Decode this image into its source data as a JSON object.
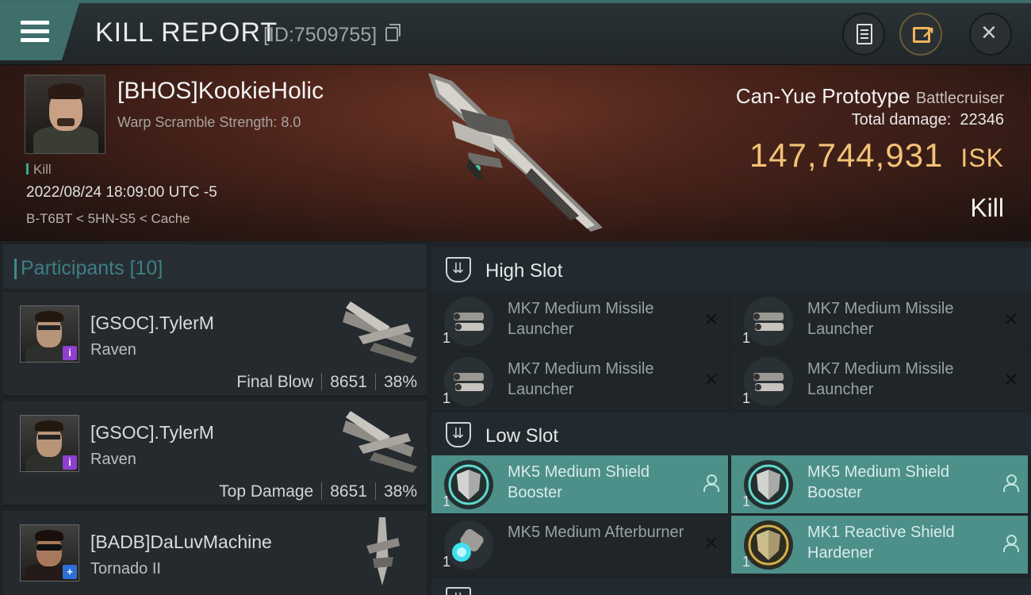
{
  "header": {
    "title": "KILL REPORT",
    "report_id": "[ID:7509755]",
    "icons": {
      "menu": "hamburger-icon",
      "copy": "copy-icon",
      "notes": "document-icon",
      "share": "share-icon",
      "close": "close-icon"
    }
  },
  "victim": {
    "name": "[BHOS]KookieHolic",
    "warp_scramble": "Warp Scramble Strength: 8.0",
    "tag": "Kill",
    "timestamp": "2022/08/24 18:09:00 UTC -5",
    "location": "B-T6BT < 5HN-S5 < Cache"
  },
  "ship": {
    "name": "Can-Yue Prototype",
    "class": "Battlecruiser",
    "total_damage_label": "Total damage:",
    "total_damage": "22346",
    "isk_value": "147,744,931",
    "isk_unit": "ISK",
    "result": "Kill"
  },
  "participants": {
    "title": "Participants",
    "count": "[10]",
    "list": [
      {
        "name": "[GSOC].TylerM",
        "ship": "Raven",
        "role": "Final Blow",
        "damage": "8651",
        "percent": "38%",
        "badge": "i",
        "badge_color": "#8e3fd0"
      },
      {
        "name": "[GSOC].TylerM",
        "ship": "Raven",
        "role": "Top Damage",
        "damage": "8651",
        "percent": "38%",
        "badge": "i",
        "badge_color": "#8e3fd0"
      },
      {
        "name": "[BADB]DaLuvMachine",
        "ship": "Tornado II",
        "badge": "+",
        "badge_color": "#2e6fd6"
      }
    ]
  },
  "slots": {
    "high": {
      "title": "High Slot",
      "modules": [
        {
          "qty": "1",
          "name": "MK7 Medium Missile Launcher",
          "fitted": false
        },
        {
          "qty": "1",
          "name": "MK7 Medium Missile Launcher",
          "fitted": false
        },
        {
          "qty": "1",
          "name": "MK7 Medium Missile Launcher",
          "fitted": false
        },
        {
          "qty": "1",
          "name": "MK7 Medium Missile Launcher",
          "fitted": false
        }
      ]
    },
    "low": {
      "title": "Low Slot",
      "modules": [
        {
          "qty": "1",
          "name": "MK5 Medium Shield Booster",
          "fitted": true
        },
        {
          "qty": "1",
          "name": "MK5 Medium Shield Booster",
          "fitted": true
        },
        {
          "qty": "1",
          "name": "MK5 Medium Afterburner",
          "fitted": false
        },
        {
          "qty": "1",
          "name": "MK1 Reactive Shield Hardener",
          "fitted": true
        }
      ]
    }
  },
  "colors": {
    "accent": "#3f6f6b",
    "isk": "#f3c276",
    "fitted": "#4d8f89"
  }
}
